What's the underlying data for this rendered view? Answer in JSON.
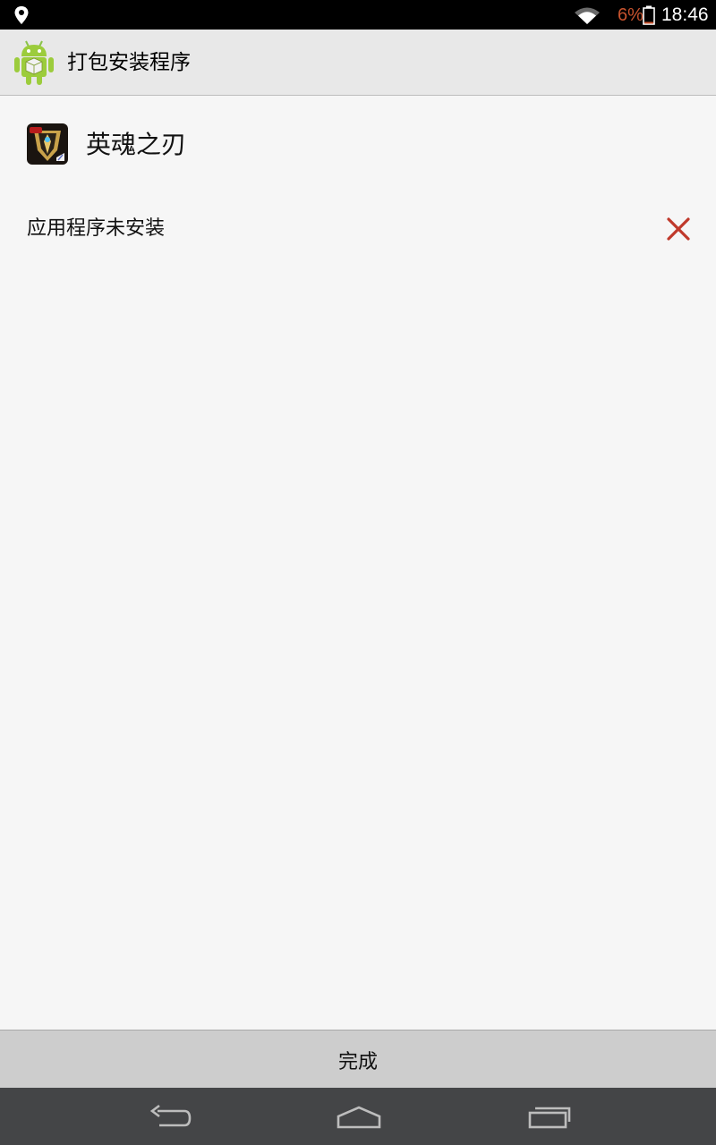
{
  "status_bar": {
    "battery_percent": "6%",
    "time": "18:46",
    "icons": [
      "location-icon",
      "wifi-icon",
      "battery-icon"
    ],
    "battery_color": "#c8532e"
  },
  "action_bar": {
    "title": "打包安装程序",
    "icon": "android-package-icon"
  },
  "app": {
    "name": "英魂之刃",
    "icon": "game-app-icon"
  },
  "install_status": {
    "message": "应用程序未安装",
    "icon": "close-icon",
    "icon_color": "#c0392b"
  },
  "footer": {
    "done_label": "完成"
  },
  "nav_bar": {
    "buttons": [
      "back-icon",
      "home-icon",
      "recent-apps-icon"
    ]
  }
}
